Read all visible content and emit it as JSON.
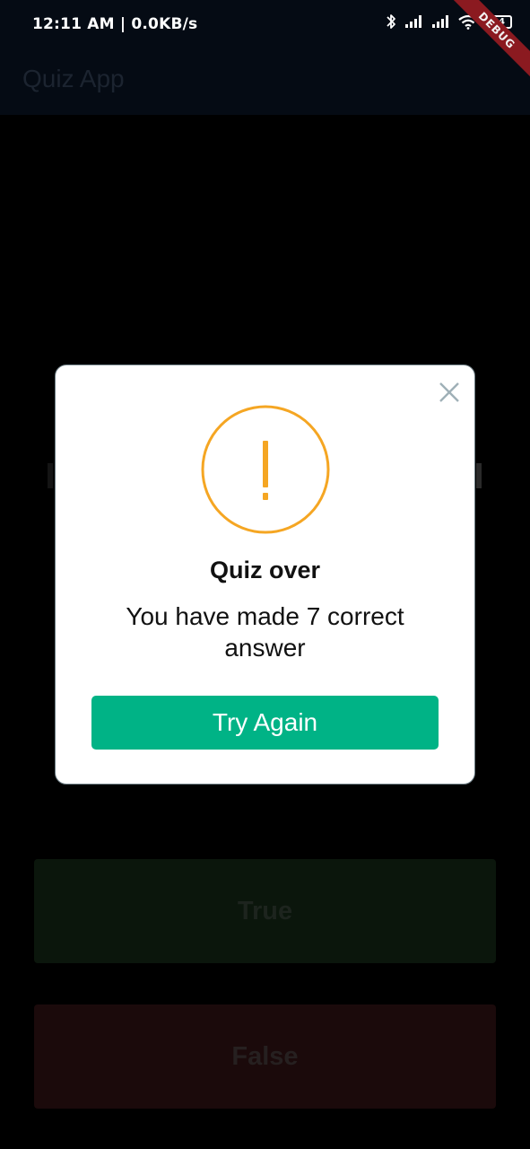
{
  "status_bar": {
    "time": "12:11 AM | 0.0KB/s",
    "battery": "44",
    "icons": [
      "bluetooth-icon",
      "signal-icon",
      "signal-icon",
      "wifi-icon",
      "battery-icon"
    ]
  },
  "app_bar": {
    "title": "Quiz App"
  },
  "debug_banner": {
    "label": "DEBUG",
    "color": "#8b1a20"
  },
  "answers": {
    "true_label": "True",
    "false_label": "False"
  },
  "dialog": {
    "icon": "exclamation-icon",
    "title": "Quiz over",
    "message": "You have made 7 correct answer",
    "button_label": "Try Again",
    "accent_color": "#f5a623",
    "button_color": "#00b386"
  }
}
